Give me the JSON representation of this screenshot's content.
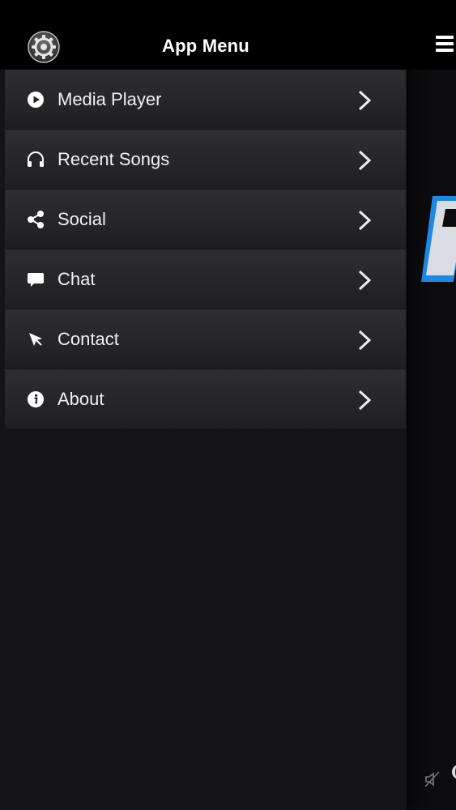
{
  "drawer": {
    "title": "App Menu",
    "settings_icon": "gear-icon"
  },
  "menu": {
    "items": [
      {
        "label": "Media Player",
        "icon": "play-icon"
      },
      {
        "label": "Recent Songs",
        "icon": "headphones-icon"
      },
      {
        "label": "Social",
        "icon": "share-icon"
      },
      {
        "label": "Chat",
        "icon": "chat-icon"
      },
      {
        "label": "Contact",
        "icon": "cursor-icon"
      },
      {
        "label": "About",
        "icon": "info-icon"
      }
    ]
  },
  "main": {
    "menu_icon": "hamburger-icon",
    "mute_icon": "speaker-mute-icon"
  },
  "colors": {
    "background": "#141416",
    "header": "#000000",
    "item": "#2a2a2d",
    "text": "#ffffff",
    "logo_accent": "#1e88e5"
  }
}
